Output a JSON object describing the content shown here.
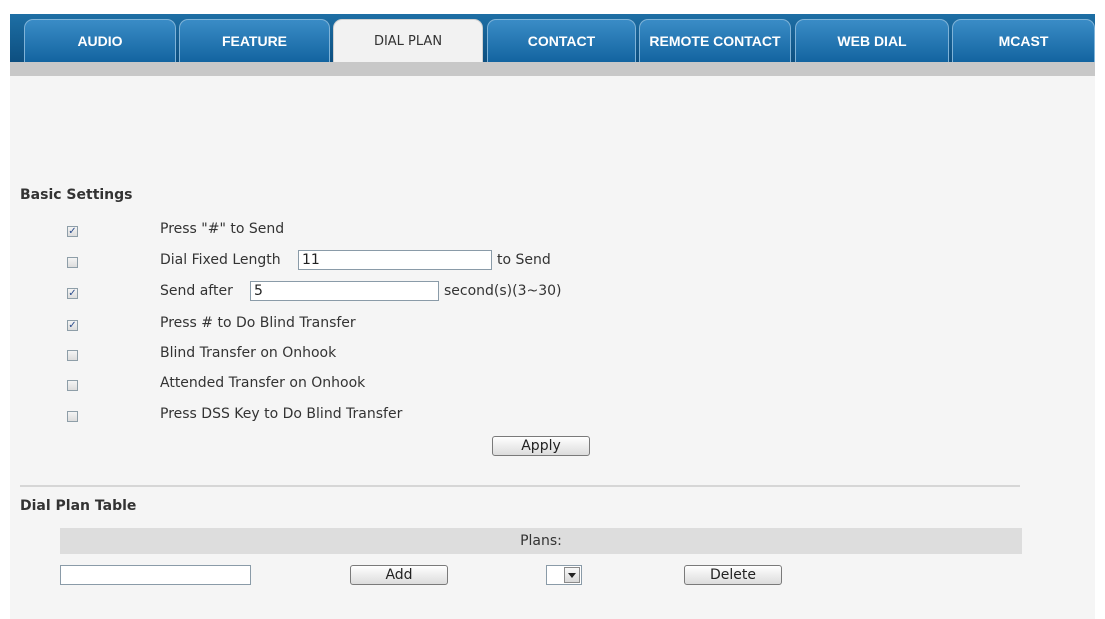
{
  "tabs": [
    {
      "label": "AUDIO",
      "active": false
    },
    {
      "label": "FEATURE",
      "active": false
    },
    {
      "label": "DIAL PLAN",
      "active": true
    },
    {
      "label": "CONTACT",
      "active": false
    },
    {
      "label": "REMOTE CONTACT",
      "active": false
    },
    {
      "label": "WEB DIAL",
      "active": false
    },
    {
      "label": "MCAST",
      "active": false
    }
  ],
  "basic_settings": {
    "title": "Basic Settings",
    "press_hash_send": {
      "label": "Press \"#\" to Send",
      "checked": true
    },
    "dial_fixed_length": {
      "label": "Dial Fixed Length",
      "value": "11",
      "suffix": "to Send",
      "checked": false
    },
    "send_after": {
      "label": "Send after",
      "value": "5",
      "suffix": "second(s)(3~30)",
      "checked": true
    },
    "press_hash_blind": {
      "label": "Press # to Do Blind Transfer",
      "checked": true
    },
    "blind_onhook": {
      "label": "Blind Transfer on Onhook",
      "checked": false
    },
    "attended_onhook": {
      "label": "Attended Transfer on Onhook",
      "checked": false
    },
    "dss_blind": {
      "label": "Press DSS Key to Do Blind Transfer",
      "checked": false
    },
    "apply_label": "Apply"
  },
  "dial_plan_table": {
    "title": "Dial Plan Table",
    "plans_header": "Plans:",
    "plan_input_value": "",
    "add_label": "Add",
    "plans_selected": "",
    "delete_label": "Delete"
  },
  "colors": {
    "tab_blue": "#1364a0",
    "tab_active_bg": "#f2f2f2",
    "content_bg": "#f5f5f5"
  }
}
